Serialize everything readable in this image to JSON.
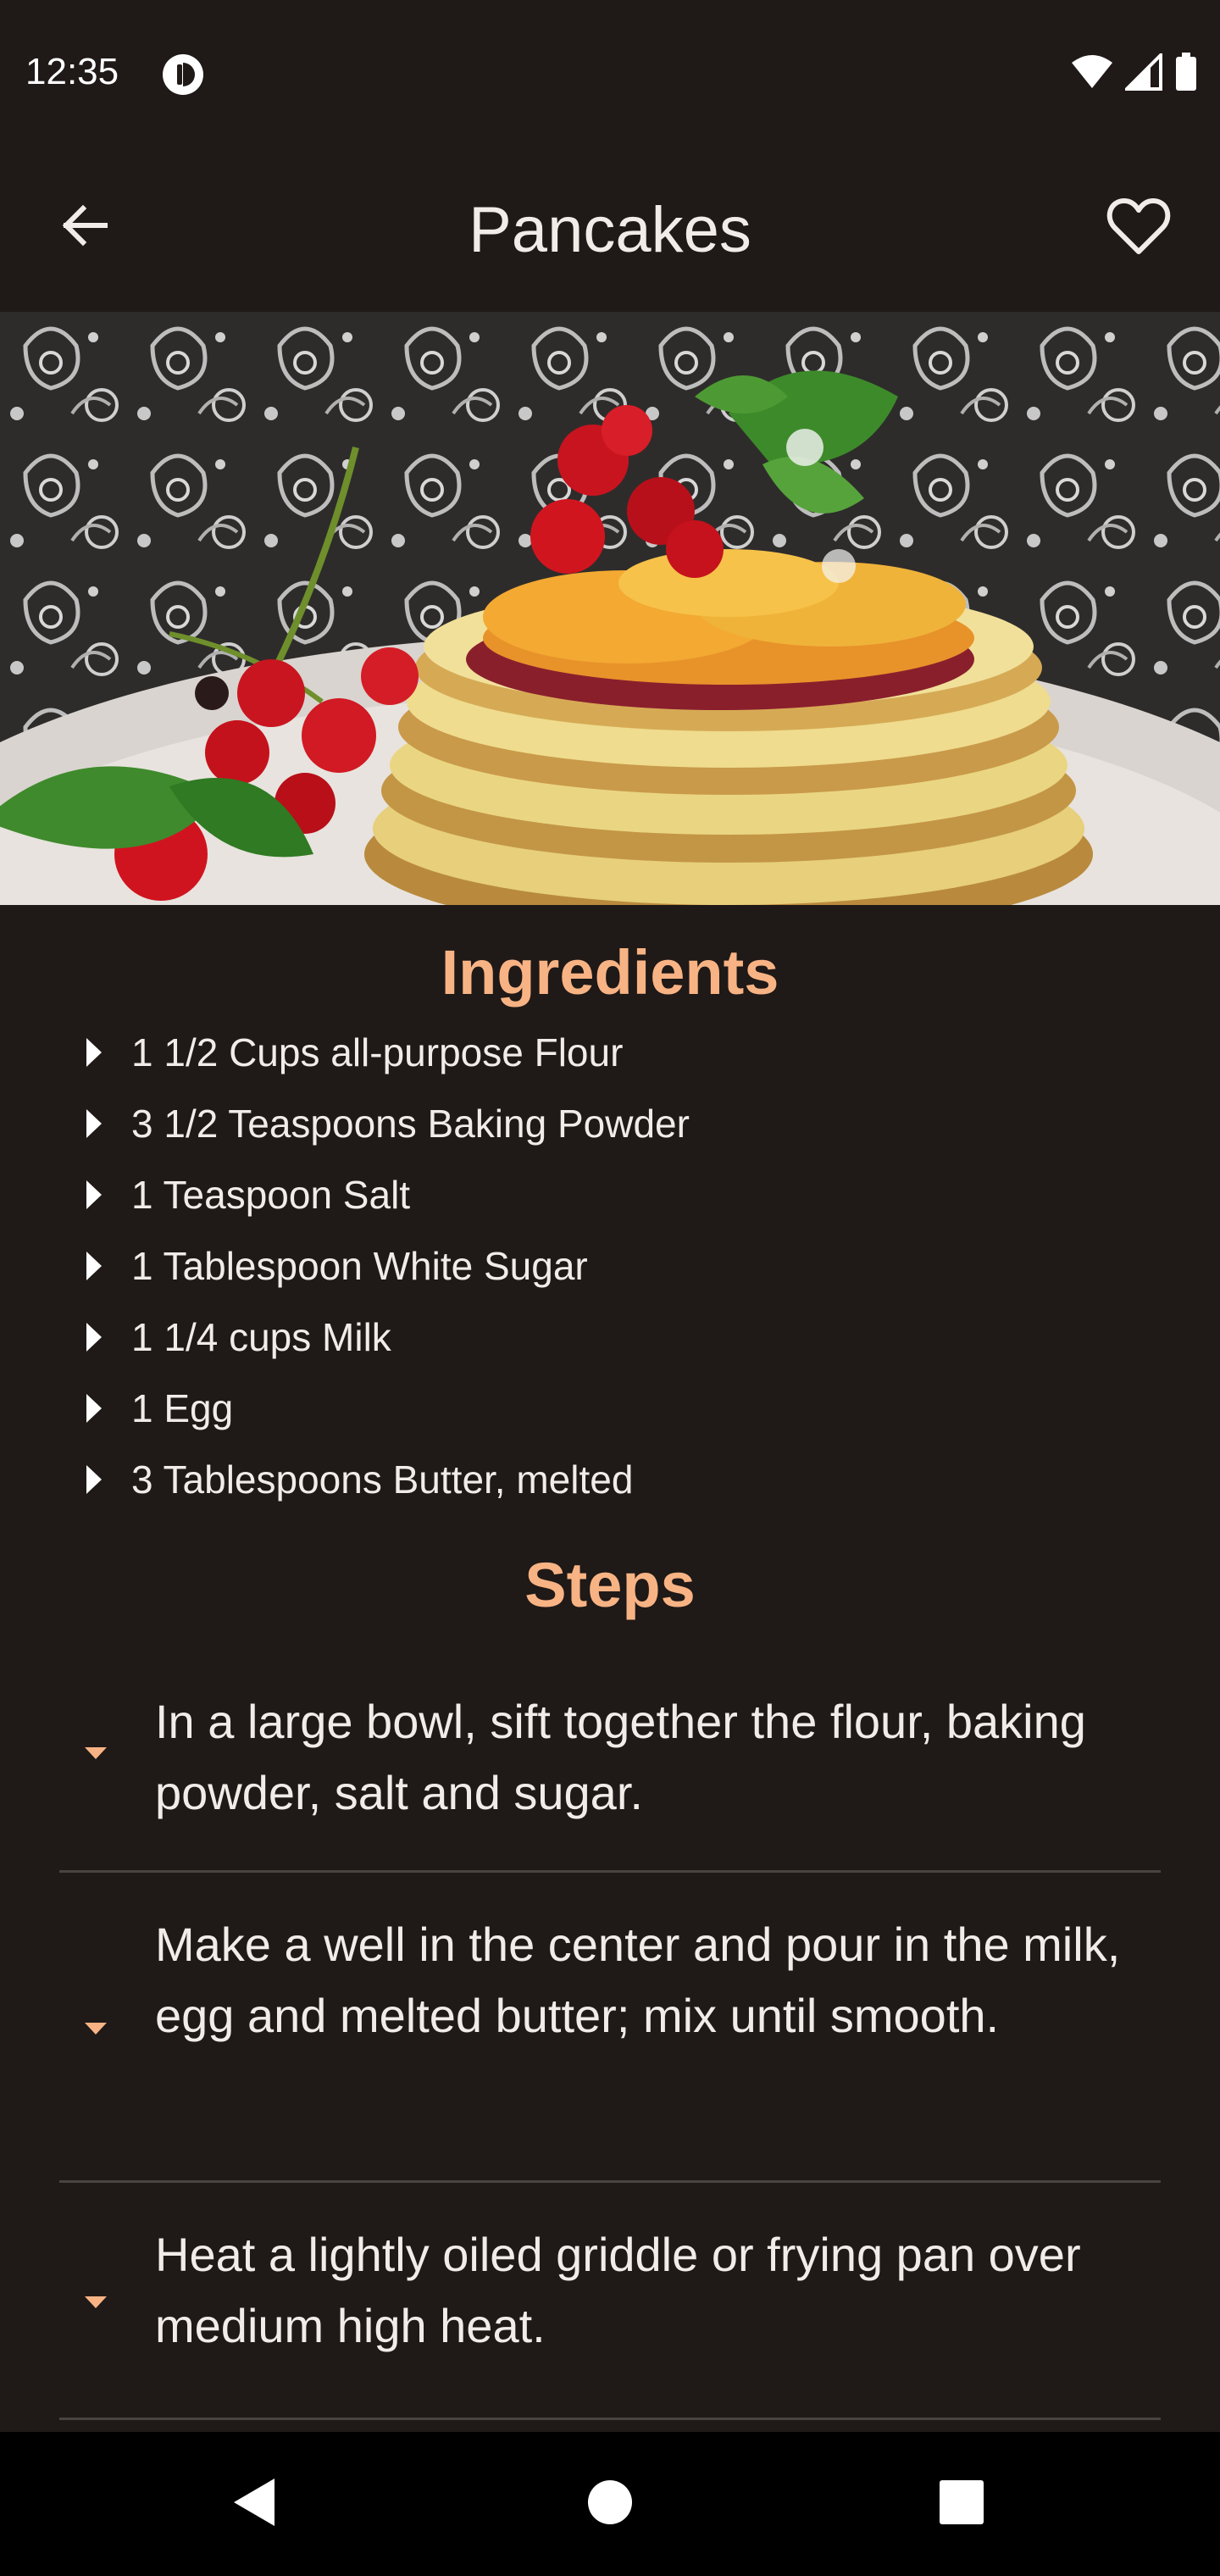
{
  "status_bar": {
    "time": "12:35",
    "icons": [
      "app-notification-icon",
      "wifi-icon",
      "cellular-signal-icon",
      "battery-icon"
    ]
  },
  "app_bar": {
    "title": "Pancakes",
    "back_icon": "arrow-back-icon",
    "favorite_icon": "heart-outline-icon"
  },
  "hero_image": {
    "subject": "stack of pancakes topped with fruit, red currants and mint"
  },
  "ingredients": {
    "title": "Ingredients",
    "items": [
      "1 1/2 Cups all-purpose Flour",
      "3 1/2 Teaspoons Baking Powder",
      "1 Teaspoon Salt",
      "1 Tablespoon White Sugar",
      "1 1/4 cups Milk",
      "1 Egg",
      "3 Tablespoons Butter, melted"
    ]
  },
  "steps": {
    "title": "Steps",
    "items": [
      "In a large bowl, sift together the flour, baking powder, salt and sugar.",
      "Make a well in the center and pour in the milk, egg and melted butter; mix until smooth.",
      "Heat a lightly oiled griddle or frying pan over medium high heat."
    ]
  },
  "nav_bar": {
    "icons": [
      "nav-back-icon",
      "nav-home-icon",
      "nav-recents-icon"
    ]
  },
  "colors": {
    "background": "#1f1917",
    "accent": "#f8b384",
    "text": "#f2ece9",
    "divider": "#4a4441"
  }
}
